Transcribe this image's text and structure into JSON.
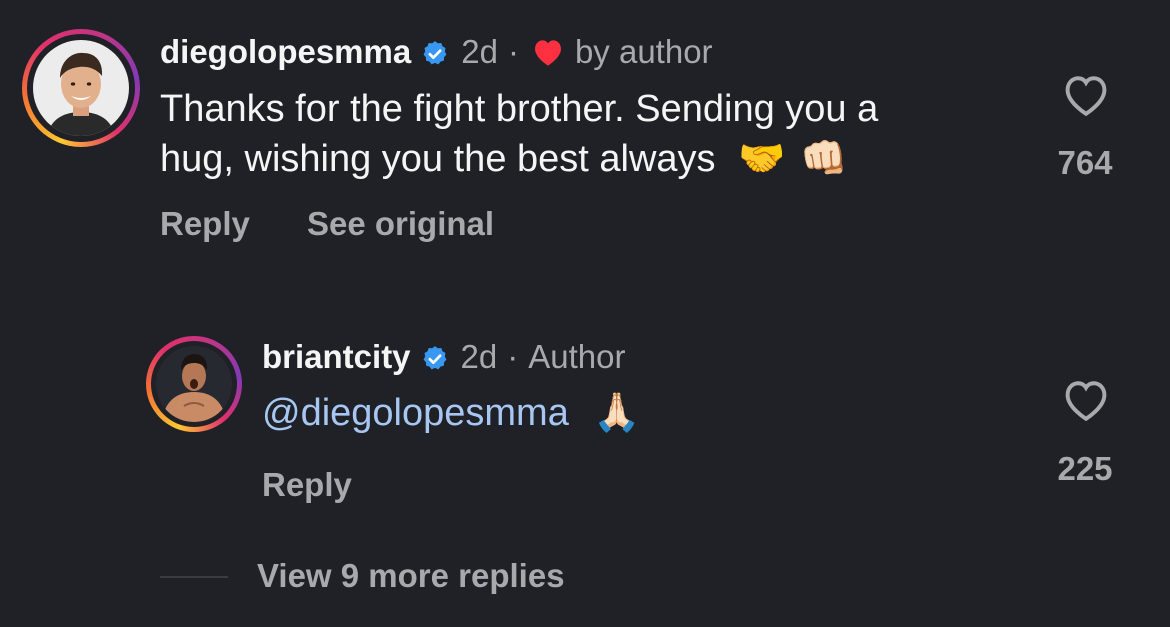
{
  "comments": [
    {
      "username": "diegolopesmma",
      "verified": true,
      "time": "2d",
      "separator": "·",
      "badge_icon": "heart-icon",
      "badge_text": "by author",
      "text_line1": "Thanks for the fight brother. Sending you a",
      "text_line2": "hug, wishing you the best always",
      "emoji1": "🤝",
      "emoji2": "👊🏻",
      "actions": {
        "reply": "Reply",
        "see_original": "See original"
      },
      "likes": "764"
    },
    {
      "username": "briantcity",
      "verified": true,
      "time": "2d",
      "separator": "·",
      "badge_text": "Author",
      "mention": "@diegolopesmma",
      "emoji": "🙏🏻",
      "actions": {
        "reply": "Reply"
      },
      "likes": "225"
    }
  ],
  "view_more": "View 9 more replies",
  "colors": {
    "background": "#1f2127",
    "primary_text": "#f5f5f5",
    "secondary_text": "#a8a8ad",
    "mention": "#a7c7f2",
    "verified": "#3897f0",
    "heart": "#ff3040"
  }
}
